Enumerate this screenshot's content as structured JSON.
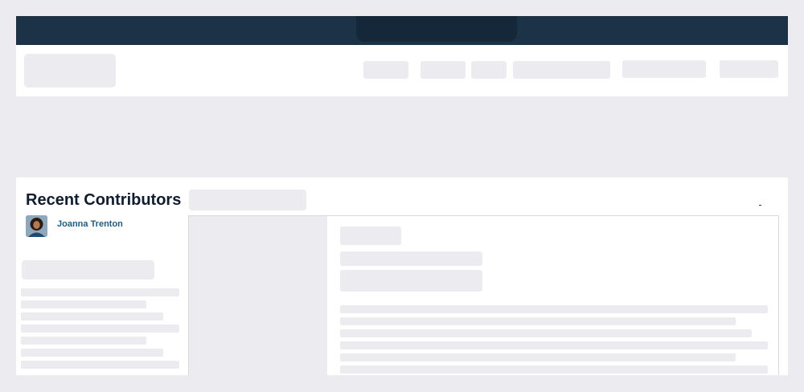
{
  "recent_contributors": {
    "title": "Recent Contributors",
    "contributors": [
      {
        "name": "Joanna Trenton"
      }
    ]
  },
  "colors": {
    "topbar": "#1c3347",
    "title_text": "#101d2e",
    "link_text": "#1d5c83",
    "page_background": "#ebebf0"
  }
}
